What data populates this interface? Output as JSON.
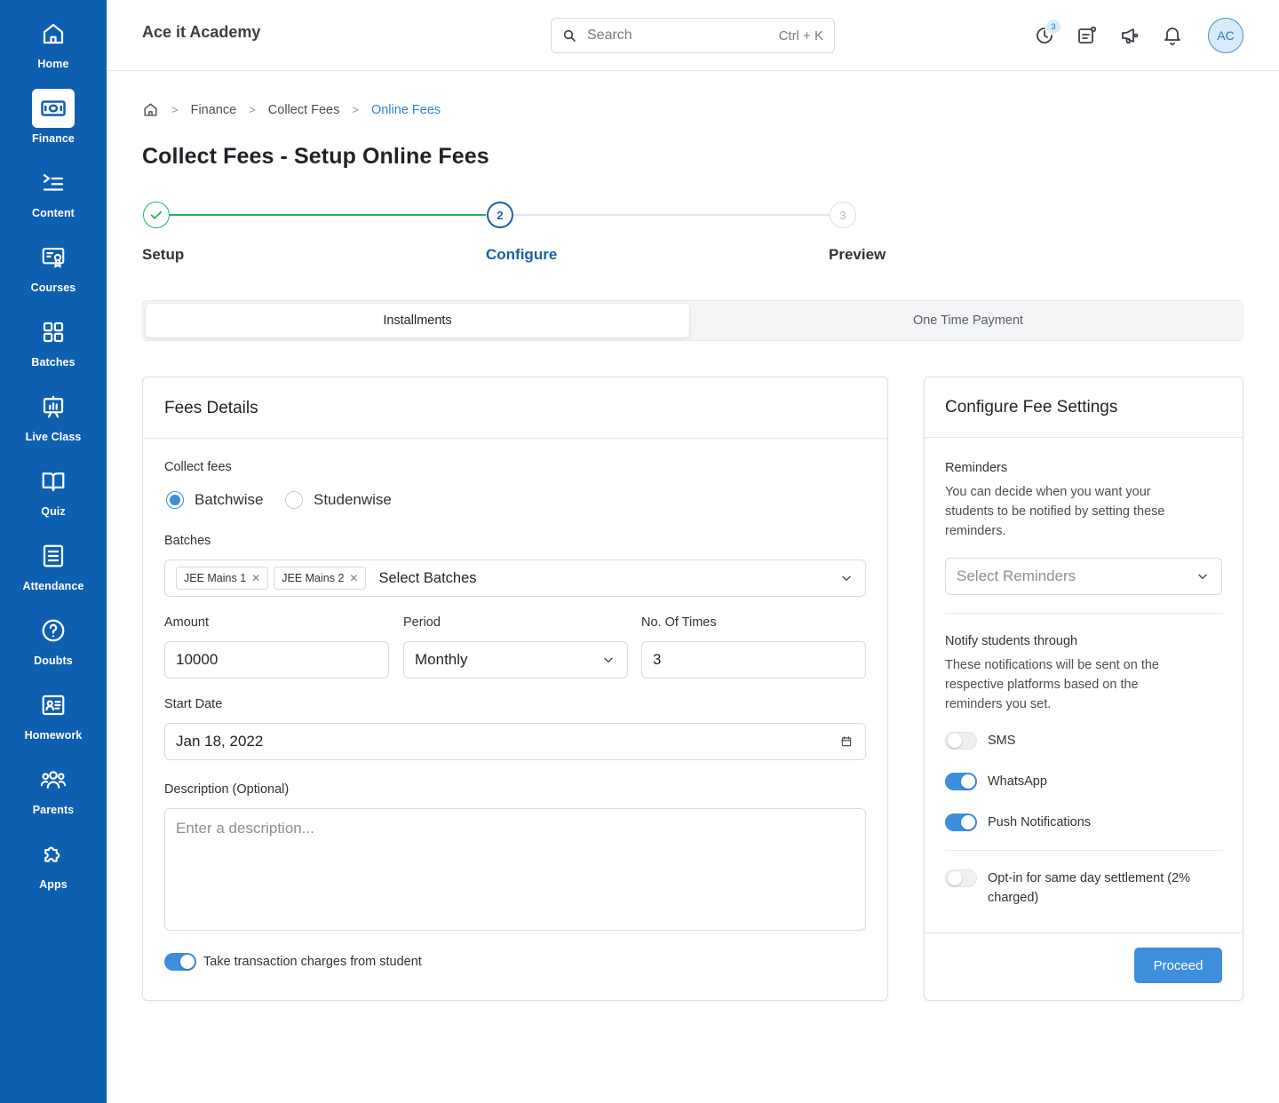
{
  "sidebar": {
    "items": [
      {
        "label": "Home",
        "icon": "home-icon"
      },
      {
        "label": "Finance",
        "icon": "cash-icon",
        "active": true
      },
      {
        "label": "Content",
        "icon": "list-icon"
      },
      {
        "label": "Courses",
        "icon": "certificate-icon"
      },
      {
        "label": "Batches",
        "icon": "grid-icon"
      },
      {
        "label": "Live Class",
        "icon": "presentation-icon"
      },
      {
        "label": "Quiz",
        "icon": "book-icon"
      },
      {
        "label": "Attendance",
        "icon": "document-icon"
      },
      {
        "label": "Doubts",
        "icon": "question-icon"
      },
      {
        "label": "Homework",
        "icon": "id-card-icon"
      },
      {
        "label": "Parents",
        "icon": "users-icon"
      },
      {
        "label": "Apps",
        "icon": "puzzle-icon"
      }
    ]
  },
  "header": {
    "title": "Ace it Academy",
    "search": {
      "placeholder": "Search",
      "shortcut": "Ctrl + K"
    },
    "activity_badge": "3",
    "avatar": "AC"
  },
  "breadcrumb": {
    "items": [
      "Finance",
      "Collect Fees",
      "Online Fees"
    ]
  },
  "page_title": "Collect Fees - Setup Online Fees",
  "stepper": {
    "steps": [
      {
        "label": "Setup",
        "number": "",
        "state": "done"
      },
      {
        "label": "Configure",
        "number": "2",
        "state": "current"
      },
      {
        "label": "Preview",
        "number": "3",
        "state": "upcoming"
      }
    ]
  },
  "tabs": [
    {
      "label": "Installments",
      "active": true
    },
    {
      "label": "One Time Payment",
      "active": false
    }
  ],
  "fees_details": {
    "title": "Fees Details",
    "collect_label": "Collect fees",
    "collect_options": [
      "Batchwise",
      "Studenwise"
    ],
    "collect_selected": "Batchwise",
    "batches_label": "Batches",
    "batches_selected": [
      "JEE Mains 1",
      "JEE Mains 2"
    ],
    "batches_placeholder": "Select Batches",
    "amount_label": "Amount",
    "amount_value": "10000",
    "period_label": "Period",
    "period_value": "Monthly",
    "times_label": "No. Of Times",
    "times_value": "3",
    "start_date_label": "Start Date",
    "start_date_value": "Jan 18, 2022",
    "description_label": "Description (Optional)",
    "description_placeholder": "Enter a description...",
    "transaction_toggle_label": "Take transaction charges from student",
    "transaction_toggle_on": true
  },
  "fee_settings": {
    "title": "Configure Fee Settings",
    "reminders_label": "Reminders",
    "reminders_help_1": "You can decide when you want your",
    "reminders_help_2": "students to be notified by setting these",
    "reminders_help_3": "reminders.",
    "reminders_placeholder": "Select Reminders",
    "notify_label": "Notify students through",
    "notify_help_1": "These notifications will be sent on the",
    "notify_help_2": "respective platforms based on the",
    "notify_help_3": "reminders you set.",
    "channels": [
      {
        "label": "SMS",
        "on": false
      },
      {
        "label": "WhatsApp",
        "on": true
      },
      {
        "label": "Push Notifications",
        "on": true
      }
    ],
    "settlement_label_1": "Opt-in for same day settlement (2%",
    "settlement_label_2": "charged)",
    "settlement_on": false,
    "proceed_label": "Proceed"
  },
  "colors": {
    "sidebar": "#0f5fb0",
    "accent": "#3d8fdc",
    "success": "#22b35e",
    "step_active": "#1a5fa8"
  }
}
